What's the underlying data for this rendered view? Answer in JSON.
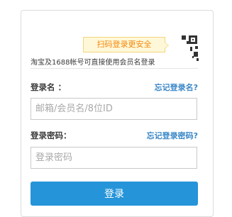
{
  "qr_tip": {
    "text": "扫码登录更安全"
  },
  "qr_corner": {
    "icon": "qr-code-icon"
  },
  "subtitle": "淘宝及1688帐号可直接使用会员名登录",
  "username": {
    "label": "登录名 ：",
    "forgot": "忘记登录名?",
    "placeholder": "邮箱/会员名/8位ID",
    "value": ""
  },
  "password": {
    "label": "登录密码：",
    "forgot": "忘记登录密码?",
    "placeholder": "登录密码",
    "value": ""
  },
  "login_button": {
    "label": "登录"
  },
  "colors": {
    "accent": "#2594d9",
    "link": "#3a87c8",
    "tip_text": "#f2870f",
    "tip_bg": "#fff8d8"
  }
}
